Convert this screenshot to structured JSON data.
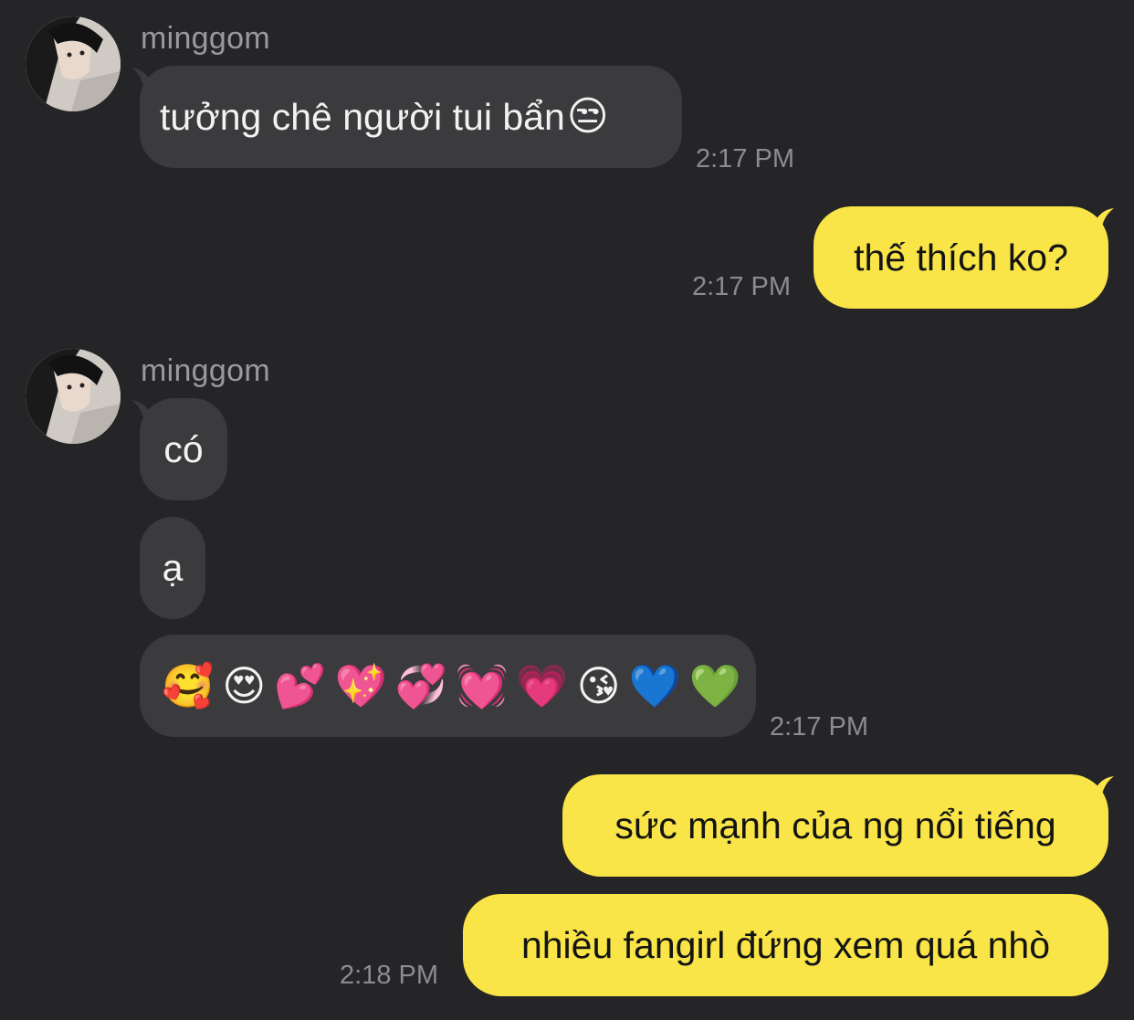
{
  "sender": {
    "name": "minggom",
    "avatar_icon": "profile-photo"
  },
  "colors": {
    "background": "#252527",
    "incoming_bubble": "#3b3b3d",
    "outgoing_bubble": "#f9e547"
  },
  "messages": [
    {
      "direction": "incoming",
      "text": "tưởng chê người tui bẩn",
      "emoji": "😒",
      "time": "2:17 PM"
    },
    {
      "direction": "outgoing",
      "text": "thế thích ko?",
      "time": "2:17 PM"
    },
    {
      "direction": "incoming",
      "text": "có"
    },
    {
      "direction": "incoming",
      "text": "ạ"
    },
    {
      "direction": "incoming",
      "emojis": [
        "🥰",
        "😍",
        "💕",
        "💖",
        "💞",
        "💓",
        "💗",
        "😘",
        "💙",
        "💚"
      ],
      "time": "2:17 PM"
    },
    {
      "direction": "outgoing",
      "text": "sức mạnh của ng nổi tiếng"
    },
    {
      "direction": "outgoing",
      "text": "nhiều fangirl đứng xem quá nhò",
      "time": "2:18 PM"
    }
  ]
}
